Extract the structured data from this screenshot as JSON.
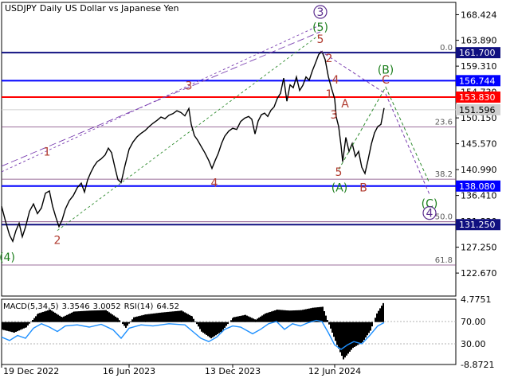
{
  "chart_data": [
    {
      "type": "line",
      "symbol": "USDJPY",
      "timeframe": "Daily",
      "description": "US Dollar vs Japanese Yen",
      "price_ticks": [
        168.424,
        163.89,
        159.31,
        154.73,
        150.15,
        145.57,
        140.99,
        136.41,
        131.83,
        127.25,
        122.67
      ],
      "y_range": [
        118.6,
        170.6
      ],
      "x_tick_labels": [
        "19 Dec 2022",
        "16 Jun 2023",
        "13 Dec 2023",
        "12 Jun 2024"
      ],
      "price_path": [
        [
          0,
          134.5
        ],
        [
          5,
          131.8
        ],
        [
          10,
          129.4
        ],
        [
          14,
          128.3
        ],
        [
          18,
          130.2
        ],
        [
          22,
          131.5
        ],
        [
          26,
          129.1
        ],
        [
          30,
          130.8
        ],
        [
          35,
          133.6
        ],
        [
          40,
          134.9
        ],
        [
          45,
          133.2
        ],
        [
          50,
          134.2
        ],
        [
          55,
          136.8
        ],
        [
          60,
          137.2
        ],
        [
          64,
          134.5
        ],
        [
          68,
          132.6
        ],
        [
          72,
          130.9
        ],
        [
          76,
          132.1
        ],
        [
          80,
          134.0
        ],
        [
          85,
          135.5
        ],
        [
          90,
          136.4
        ],
        [
          95,
          137.8
        ],
        [
          100,
          138.6
        ],
        [
          104,
          137.0
        ],
        [
          108,
          139.2
        ],
        [
          112,
          140.5
        ],
        [
          116,
          141.6
        ],
        [
          120,
          142.4
        ],
        [
          125,
          142.9
        ],
        [
          130,
          143.6
        ],
        [
          134,
          144.8
        ],
        [
          138,
          144.0
        ],
        [
          142,
          141.5
        ],
        [
          146,
          139.2
        ],
        [
          150,
          138.7
        ],
        [
          155,
          141.8
        ],
        [
          160,
          144.6
        ],
        [
          165,
          145.9
        ],
        [
          170,
          146.8
        ],
        [
          175,
          147.4
        ],
        [
          180,
          147.9
        ],
        [
          185,
          148.6
        ],
        [
          190,
          149.2
        ],
        [
          195,
          149.7
        ],
        [
          200,
          150.3
        ],
        [
          205,
          150.0
        ],
        [
          210,
          150.6
        ],
        [
          215,
          150.9
        ],
        [
          220,
          151.4
        ],
        [
          225,
          151.1
        ],
        [
          230,
          150.5
        ],
        [
          235,
          151.8
        ],
        [
          238,
          149.0
        ],
        [
          242,
          147.0
        ],
        [
          246,
          146.2
        ],
        [
          250,
          145.2
        ],
        [
          255,
          144.0
        ],
        [
          260,
          142.6
        ],
        [
          264,
          141.2
        ],
        [
          268,
          142.6
        ],
        [
          272,
          143.9
        ],
        [
          276,
          145.6
        ],
        [
          280,
          146.9
        ],
        [
          285,
          147.8
        ],
        [
          290,
          148.3
        ],
        [
          295,
          148.1
        ],
        [
          300,
          149.5
        ],
        [
          305,
          150.1
        ],
        [
          310,
          150.4
        ],
        [
          314,
          149.9
        ],
        [
          318,
          147.3
        ],
        [
          322,
          149.6
        ],
        [
          326,
          150.7
        ],
        [
          330,
          151.0
        ],
        [
          334,
          150.4
        ],
        [
          338,
          151.5
        ],
        [
          342,
          152.1
        ],
        [
          346,
          153.6
        ],
        [
          350,
          154.5
        ],
        [
          354,
          157.2
        ],
        [
          358,
          153.1
        ],
        [
          362,
          156.0
        ],
        [
          366,
          155.5
        ],
        [
          370,
          157.4
        ],
        [
          374,
          155.0
        ],
        [
          378,
          155.9
        ],
        [
          382,
          157.4
        ],
        [
          386,
          156.8
        ],
        [
          390,
          158.5
        ],
        [
          394,
          159.9
        ],
        [
          398,
          161.4
        ],
        [
          402,
          161.9
        ],
        [
          406,
          160.5
        ],
        [
          410,
          157.5
        ],
        [
          414,
          155.4
        ],
        [
          418,
          153.5
        ],
        [
          420,
          150.3
        ],
        [
          423,
          148.6
        ],
        [
          426,
          145.2
        ],
        [
          428,
          142.4
        ],
        [
          432,
          146.7
        ],
        [
          436,
          144.2
        ],
        [
          440,
          145.6
        ],
        [
          444,
          143.3
        ],
        [
          448,
          144.2
        ],
        [
          452,
          141.4
        ],
        [
          456,
          140.3
        ],
        [
          460,
          142.8
        ],
        [
          464,
          145.5
        ],
        [
          468,
          147.5
        ],
        [
          472,
          148.6
        ],
        [
          476,
          149.0
        ],
        [
          480,
          151.9
        ]
      ],
      "horizontal_levels": [
        {
          "label": "161.700",
          "value": 161.7,
          "color": "#101080"
        },
        {
          "label": "156.744",
          "value": 156.744,
          "color": "#0000ff"
        },
        {
          "label": "153.830",
          "value": 153.83,
          "color": "#ff0000"
        },
        {
          "label": "151.596",
          "value": 151.596,
          "color": "#d0d0d0"
        },
        {
          "label": "138.080",
          "value": 138.08,
          "color": "#0000ff"
        },
        {
          "label": "131.250",
          "value": 131.25,
          "color": "#101080"
        }
      ],
      "fibonacci_levels": [
        {
          "label": "0.0",
          "value": 161.7
        },
        {
          "label": "23.6",
          "value": 148.55
        },
        {
          "label": "38.2",
          "value": 139.3
        },
        {
          "label": "50.0",
          "value": 131.75
        },
        {
          "label": "61.8",
          "value": 124.1
        }
      ],
      "wave_labels": [
        {
          "text": "(4)",
          "x": 7,
          "y": 124.8,
          "color": "#1b7e1b"
        },
        {
          "text": "1",
          "x": 57,
          "y": 143.5,
          "color": "#b03a2e"
        },
        {
          "text": "2",
          "x": 70,
          "y": 127.8,
          "color": "#b03a2e"
        },
        {
          "text": "3",
          "x": 235,
          "y": 155.2,
          "color": "#b03a2e"
        },
        {
          "text": "4",
          "x": 267,
          "y": 138.0,
          "color": "#b03a2e"
        },
        {
          "text": "(5)",
          "x": 400,
          "y": 165.5,
          "color": "#1b7e1b"
        },
        {
          "text": "5",
          "x": 400,
          "y": 163.4,
          "color": "#b03a2e"
        },
        {
          "text": "2",
          "x": 411,
          "y": 160.0,
          "color": "#b03a2e"
        },
        {
          "text": "4",
          "x": 419,
          "y": 156.2,
          "color": "#b03a2e"
        },
        {
          "text": "1",
          "x": 411,
          "y": 153.7,
          "color": "#b03a2e"
        },
        {
          "text": "3",
          "x": 417,
          "y": 150.0,
          "color": "#b03a2e"
        },
        {
          "text": "A",
          "x": 431,
          "y": 152.0,
          "color": "#b03a2e"
        },
        {
          "text": "5",
          "x": 423,
          "y": 139.9,
          "color": "#b03a2e"
        },
        {
          "text": "(A)",
          "x": 424,
          "y": 137.1,
          "color": "#1b7e1b"
        },
        {
          "text": "B",
          "x": 454,
          "y": 137.1,
          "color": "#b03a2e"
        },
        {
          "text": "(B)",
          "x": 482,
          "y": 158.0,
          "color": "#1b7e1b"
        },
        {
          "text": "C",
          "x": 482,
          "y": 156.2,
          "color": "#b03a2e"
        },
        {
          "text": "(C)",
          "x": 537,
          "y": 134.3,
          "color": "#1b7e1b"
        }
      ],
      "circled_labels": [
        {
          "text": "3",
          "x": 400,
          "y": 168.2,
          "color": "#5b2d8e"
        },
        {
          "text": "4",
          "x": 537,
          "y": 132.6,
          "color": "#5b2d8e"
        }
      ],
      "projections": [
        {
          "points": [
            [
              400,
              162.0
            ],
            [
              482,
              154.4
            ],
            [
              537,
              136.6
            ]
          ],
          "color": "#7a3fb0"
        },
        {
          "points": [
            [
              423,
              141.0
            ],
            [
              482,
              155.6
            ],
            [
              537,
              138.6
            ]
          ],
          "color": "#2e8b2e"
        }
      ],
      "trend_lines": [
        {
          "points": [
            [
              0,
              141.6
            ],
            [
              400,
              165.4
            ]
          ],
          "color": "#7a3fb0",
          "style": "longdash"
        },
        {
          "points": [
            [
              0,
              140.6
            ],
            [
              400,
              166.6
            ]
          ],
          "color": "#7a3fb0",
          "style": "shortdash"
        },
        {
          "points": [
            [
              70,
              130.2
            ],
            [
              400,
              165.0
            ]
          ],
          "color": "#2e8b2e",
          "style": "shortdash"
        }
      ]
    },
    {
      "type": "bar",
      "indicator": "MACD(5,34,5)",
      "macd_value": "3.3546",
      "signal_value": "3.0052",
      "rsi_label": "RSI(14)",
      "rsi_value": "64.52",
      "y_ticks": [
        "4.7751",
        "70.00",
        "30.00",
        "-8.8721"
      ],
      "macd_range": [
        -8.8721,
        4.7751
      ],
      "macd_histogram": [
        [
          0,
          -1.6
        ],
        [
          15,
          -2.2
        ],
        [
          30,
          -1.1
        ],
        [
          45,
          1.8
        ],
        [
          60,
          2.6
        ],
        [
          75,
          1.0
        ],
        [
          90,
          2.2
        ],
        [
          110,
          2.4
        ],
        [
          130,
          2.5
        ],
        [
          145,
          0.8
        ],
        [
          155,
          -1.2
        ],
        [
          165,
          1.0
        ],
        [
          180,
          1.6
        ],
        [
          200,
          2.0
        ],
        [
          225,
          2.4
        ],
        [
          238,
          1.2
        ],
        [
          250,
          -2.0
        ],
        [
          262,
          -3.4
        ],
        [
          275,
          -2.0
        ],
        [
          290,
          1.0
        ],
        [
          305,
          1.5
        ],
        [
          318,
          0.5
        ],
        [
          330,
          1.8
        ],
        [
          345,
          2.6
        ],
        [
          360,
          2.4
        ],
        [
          375,
          2.5
        ],
        [
          390,
          3.0
        ],
        [
          402,
          3.2
        ],
        [
          410,
          -0.5
        ],
        [
          420,
          -4.8
        ],
        [
          428,
          -7.8
        ],
        [
          440,
          -5.4
        ],
        [
          452,
          -4.2
        ],
        [
          462,
          -1.8
        ],
        [
          470,
          1.8
        ],
        [
          480,
          4.5
        ]
      ],
      "rsi_series": [
        [
          0,
          42
        ],
        [
          10,
          36
        ],
        [
          20,
          45
        ],
        [
          30,
          40
        ],
        [
          40,
          58
        ],
        [
          50,
          66
        ],
        [
          60,
          60
        ],
        [
          70,
          52
        ],
        [
          80,
          62
        ],
        [
          95,
          64
        ],
        [
          110,
          60
        ],
        [
          125,
          65
        ],
        [
          140,
          55
        ],
        [
          150,
          40
        ],
        [
          160,
          58
        ],
        [
          175,
          64
        ],
        [
          190,
          62
        ],
        [
          210,
          66
        ],
        [
          230,
          64
        ],
        [
          240,
          52
        ],
        [
          250,
          40
        ],
        [
          260,
          34
        ],
        [
          270,
          42
        ],
        [
          280,
          56
        ],
        [
          290,
          62
        ],
        [
          300,
          60
        ],
        [
          315,
          48
        ],
        [
          325,
          56
        ],
        [
          335,
          66
        ],
        [
          345,
          70
        ],
        [
          355,
          56
        ],
        [
          365,
          66
        ],
        [
          375,
          62
        ],
        [
          385,
          68
        ],
        [
          395,
          72
        ],
        [
          402,
          70
        ],
        [
          410,
          50
        ],
        [
          418,
          28
        ],
        [
          426,
          20
        ],
        [
          434,
          28
        ],
        [
          442,
          34
        ],
        [
          452,
          30
        ],
        [
          462,
          45
        ],
        [
          472,
          62
        ],
        [
          480,
          68
        ]
      ]
    }
  ]
}
